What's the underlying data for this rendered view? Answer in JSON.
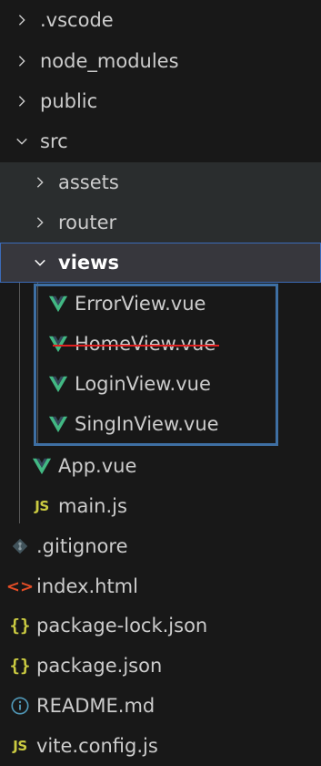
{
  "explorer": {
    "items": [
      {
        "label": ".vscode",
        "kind": "folder",
        "expanded": false,
        "depth": 0
      },
      {
        "label": "node_modules",
        "kind": "folder",
        "expanded": false,
        "depth": 0
      },
      {
        "label": "public",
        "kind": "folder",
        "expanded": false,
        "depth": 0
      },
      {
        "label": "src",
        "kind": "folder",
        "expanded": true,
        "depth": 0
      },
      {
        "label": "assets",
        "kind": "folder",
        "expanded": false,
        "depth": 1
      },
      {
        "label": "router",
        "kind": "folder",
        "expanded": false,
        "depth": 1
      },
      {
        "label": "views",
        "kind": "folder",
        "expanded": true,
        "depth": 1,
        "active": true
      },
      {
        "label": "ErrorView.vue",
        "kind": "vue",
        "depth": 2
      },
      {
        "label": "HomeView.vue",
        "kind": "vue",
        "depth": 2,
        "struck": true
      },
      {
        "label": "LoginView.vue",
        "kind": "vue",
        "depth": 2
      },
      {
        "label": "SingInView.vue",
        "kind": "vue",
        "depth": 2
      },
      {
        "label": "App.vue",
        "kind": "vue",
        "depth": 1
      },
      {
        "label": "main.js",
        "kind": "js",
        "depth": 1
      },
      {
        "label": ".gitignore",
        "kind": "git",
        "depth": 0
      },
      {
        "label": "index.html",
        "kind": "html",
        "depth": 0
      },
      {
        "label": "package-lock.json",
        "kind": "json",
        "depth": 0
      },
      {
        "label": "package.json",
        "kind": "json",
        "depth": 0
      },
      {
        "label": "README.md",
        "kind": "info",
        "depth": 0
      },
      {
        "label": "vite.config.js",
        "kind": "js",
        "depth": 0
      }
    ]
  },
  "icons": {
    "js_text": "JS",
    "json_text": "{}",
    "html_text": "<>"
  },
  "colors": {
    "vue_green": "#42b883",
    "js_yellow": "#cbcb41",
    "html_orange": "#e44d26",
    "info_blue": "#519aba",
    "highlight_border": "#3e6fa3",
    "strike_red": "#e02020"
  }
}
